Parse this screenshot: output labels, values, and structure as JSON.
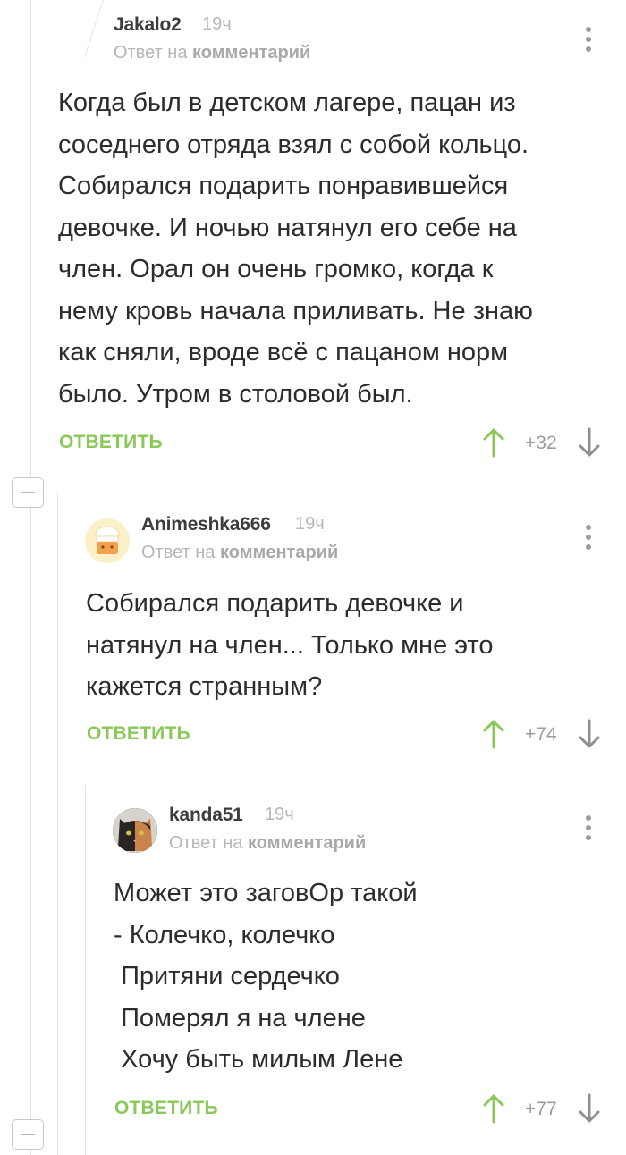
{
  "comments": [
    {
      "author": "Jakalo2",
      "time": "19ч",
      "reply_prefix": "Ответ на",
      "reply_link": "комментарий",
      "body": "Когда был в детском лагере, пацан из\nсоседнего отряда взял с собой кольцо.\nСобирался подарить понравившейся\nдевочке. И ночью натянул его себе на\nчлен. Орал он очень громко, когда к\nнему кровь начала приливать. Не знаю\nкак сняли, вроде всё с пацаном норм\nбыло. Утром в столовой был.",
      "reply_label": "ОТВЕТИТЬ",
      "rating": "+32"
    },
    {
      "author": "Animeshka666",
      "time": "19ч",
      "reply_prefix": "Ответ на",
      "reply_link": "комментарий",
      "body": "Собирался подарить девочке и\nнатянул на член... Только мне это\nкажется странным?",
      "reply_label": "ОТВЕТИТЬ",
      "rating": "+74"
    },
    {
      "author": "kanda51",
      "time": "19ч",
      "reply_prefix": "Ответ на",
      "reply_link": "комментарий",
      "body": "Может это заговОр такой\n- Колечко, колечко\n Притяни сердечко\n Померял я на члене\n Хочу быть милым Лене",
      "reply_label": "ОТВЕТИТЬ",
      "rating": "+77"
    }
  ],
  "colors": {
    "reply": "#8ac858",
    "upvote": "#8ac858",
    "downvote": "#8f8f8f",
    "meta": "#b8b8b8"
  },
  "icons": {
    "menu": "three-dots-vertical-icon",
    "upvote": "arrow-up-icon",
    "downvote": "arrow-down-icon",
    "collapse": "minus-square-icon"
  }
}
